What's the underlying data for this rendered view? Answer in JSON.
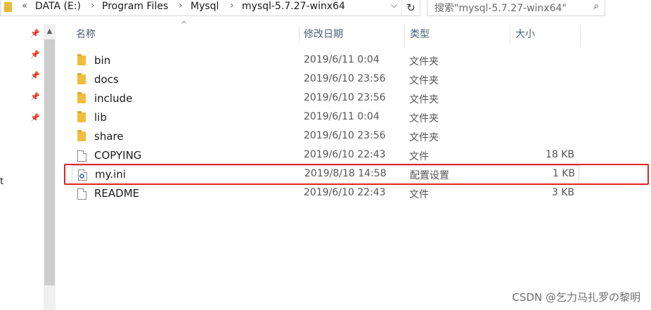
{
  "address": {
    "overflow": "«",
    "crumbs": [
      "DATA (E:)",
      "Program Files",
      "Mysql",
      "mysql-5.7.27-winx64"
    ],
    "separator": "›",
    "dropdown": "⌵",
    "refresh": "↻"
  },
  "search": {
    "placeholder": "搜索\"mysql-5.7.27-winx64\"",
    "icon": "⌕"
  },
  "left_stub": "t",
  "pin_glyph": "📌",
  "columns": {
    "name": "名称",
    "date": "修改日期",
    "type": "类型",
    "size": "大小"
  },
  "sort_indicator": "^",
  "files": [
    {
      "name": "bin",
      "date": "2019/6/11 0:04",
      "type": "文件夹",
      "size": "",
      "icon": "folder-icon"
    },
    {
      "name": "docs",
      "date": "2019/6/10 23:56",
      "type": "文件夹",
      "size": "",
      "icon": "folder-icon"
    },
    {
      "name": "include",
      "date": "2019/6/10 23:56",
      "type": "文件夹",
      "size": "",
      "icon": "folder-icon"
    },
    {
      "name": "lib",
      "date": "2019/6/11 0:04",
      "type": "文件夹",
      "size": "",
      "icon": "folder-icon"
    },
    {
      "name": "share",
      "date": "2019/6/10 23:56",
      "type": "文件夹",
      "size": "",
      "icon": "folder-icon"
    },
    {
      "name": "COPYING",
      "date": "2019/6/10 22:43",
      "type": "文件",
      "size": "18 KB",
      "icon": "file-icon"
    },
    {
      "name": "my.ini",
      "date": "2019/8/18 14:58",
      "type": "配置设置",
      "size": "1 KB",
      "icon": "config-file-icon"
    },
    {
      "name": "README",
      "date": "2019/6/10 22:43",
      "type": "文件",
      "size": "3 KB",
      "icon": "file-icon"
    }
  ],
  "watermark": "CSDN @乞力马扎罗の黎明",
  "colors": {
    "highlight": "#e2251d",
    "folder": "#f2bd3d",
    "header_text": "#4c607a"
  }
}
